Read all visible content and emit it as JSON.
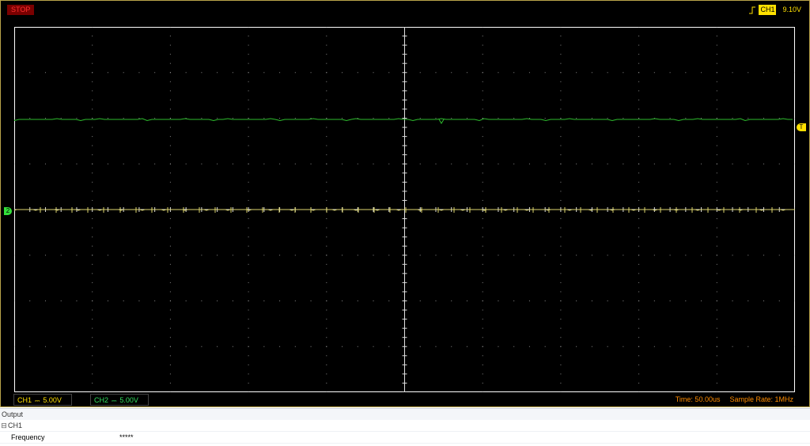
{
  "scope": {
    "status": "STOP",
    "trigger": {
      "channel": "CH1",
      "level": "9.10V"
    },
    "marker_trigger": "T",
    "marker_ch2": "2",
    "ch1": {
      "label": "CH1",
      "coupling": "⎓",
      "scale": "5.00V"
    },
    "ch2": {
      "label": "CH2",
      "coupling": "⎓",
      "scale": "5.00V"
    },
    "time": "Time: 50.00us",
    "sample": "Sample Rate: 1MHz",
    "colors": {
      "ch1": "#e0d870",
      "ch2": "#2ebd2e",
      "grid": "#bfbfbf",
      "frame": "#ffffff"
    }
  },
  "output": {
    "title": "Output",
    "group": "CH1",
    "tree_icon": "⊟",
    "rows": [
      {
        "name": "Frequency",
        "value": "*****"
      }
    ]
  }
}
